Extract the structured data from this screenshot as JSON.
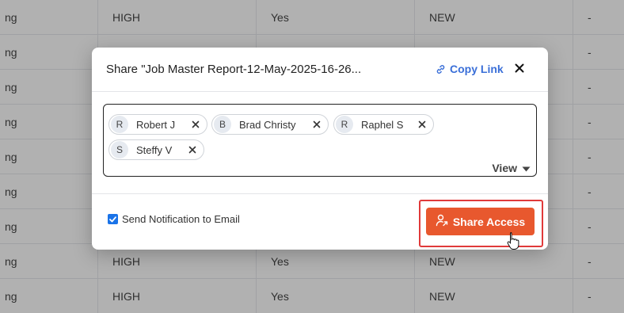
{
  "background_table": {
    "rows": [
      {
        "c0": "ng",
        "c1": "HIGH",
        "c2": "Yes",
        "c3": "NEW",
        "c4": "-"
      },
      {
        "c0": "ng",
        "c1": "",
        "c2": "",
        "c3": "",
        "c4": "-"
      },
      {
        "c0": "ng",
        "c1": "",
        "c2": "",
        "c3": "",
        "c4": "-"
      },
      {
        "c0": "ng",
        "c1": "",
        "c2": "",
        "c3": "",
        "c4": "-"
      },
      {
        "c0": "ng",
        "c1": "",
        "c2": "",
        "c3": "",
        "c4": "-"
      },
      {
        "c0": "ng",
        "c1": "",
        "c2": "",
        "c3": "",
        "c4": "-"
      },
      {
        "c0": "ng",
        "c1": "",
        "c2": "",
        "c3": "",
        "c4": "-"
      },
      {
        "c0": "ng",
        "c1": "HIGH",
        "c2": "Yes",
        "c3": "NEW",
        "c4": "-"
      },
      {
        "c0": "ng",
        "c1": "HIGH",
        "c2": "Yes",
        "c3": "NEW",
        "c4": "-"
      }
    ]
  },
  "modal": {
    "title": "Share \"Job Master Report-12-May-2025-16-26...",
    "copy_link_label": "Copy Link",
    "close_icon": "close-icon",
    "recipients": [
      {
        "initial": "R",
        "name": "Robert J"
      },
      {
        "initial": "B",
        "name": "Brad Christy"
      },
      {
        "initial": "R",
        "name": "Raphel S"
      },
      {
        "initial": "S",
        "name": "Steffy V"
      }
    ],
    "view_label": "View",
    "notify_label": "Send Notification to Email",
    "notify_checked": true,
    "share_button_label": "Share Access"
  },
  "colors": {
    "accent": "#e8582e",
    "link": "#3a6fd8",
    "checkbox": "#1a73e8",
    "highlight": "#e03a3a"
  }
}
